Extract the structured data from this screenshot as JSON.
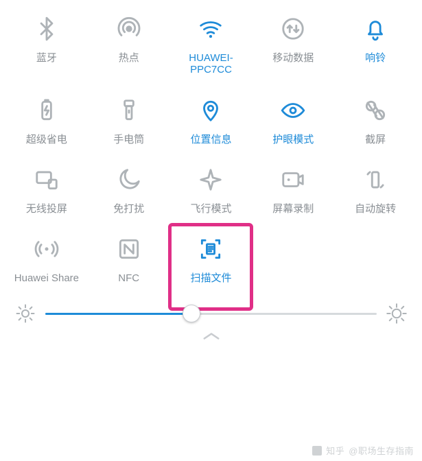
{
  "tiles": [
    {
      "id": "bluetooth",
      "label": "蓝牙",
      "active": false
    },
    {
      "id": "hotspot",
      "label": "热点",
      "active": false
    },
    {
      "id": "wifi",
      "label": "HUAWEI-\nPPC7CC",
      "active": true
    },
    {
      "id": "mobiledata",
      "label": "移动数据",
      "active": false
    },
    {
      "id": "ring",
      "label": "响铃",
      "active": true
    },
    {
      "id": "powersave",
      "label": "超级省电",
      "active": false
    },
    {
      "id": "flashlight",
      "label": "手电筒",
      "active": false
    },
    {
      "id": "location",
      "label": "位置信息",
      "active": true
    },
    {
      "id": "eyecare",
      "label": "护眼模式",
      "active": true
    },
    {
      "id": "screenshot",
      "label": "截屏",
      "active": false
    },
    {
      "id": "cast",
      "label": "无线投屏",
      "active": false
    },
    {
      "id": "dnd",
      "label": "免打扰",
      "active": false
    },
    {
      "id": "airplane",
      "label": "飞行模式",
      "active": false
    },
    {
      "id": "screenrec",
      "label": "屏幕录制",
      "active": false
    },
    {
      "id": "autorotate",
      "label": "自动旋转",
      "active": false
    },
    {
      "id": "huaweishare",
      "label": "Huawei Share",
      "active": false
    },
    {
      "id": "nfc",
      "label": "NFC",
      "active": false
    },
    {
      "id": "scandoc",
      "label": "扫描文件",
      "active": true,
      "highlight": true
    }
  ],
  "brightness": {
    "percent": 44
  },
  "watermark": {
    "site": "知乎",
    "author": "@职场生存指南"
  },
  "colors": {
    "accent": "#1e8bd8",
    "gray": "#aeb3b7",
    "highlight": "#e02f87"
  }
}
